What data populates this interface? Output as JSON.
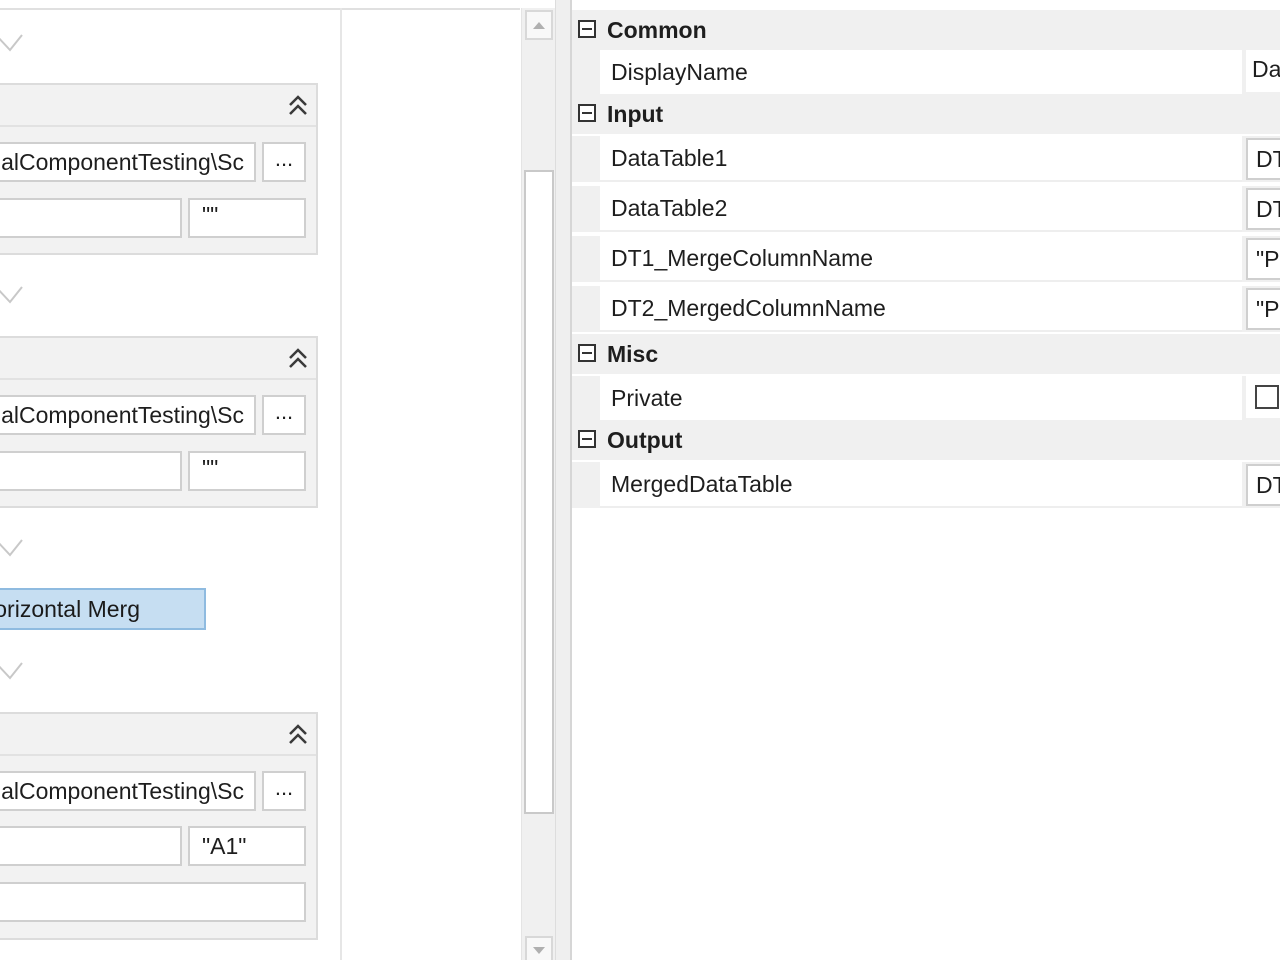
{
  "designer": {
    "activities": [
      {
        "path_value": "C:\\Test\\FunctionalComponentTesting\\Sc",
        "browse_label": "...",
        "sheet_value": "",
        "range_value": "\"\""
      },
      {
        "path_value": "C:\\Test\\FunctionalComponentTesting\\Sc",
        "browse_label": "...",
        "sheet_value": "",
        "range_value": "\"\""
      },
      {
        "path_value": "C:\\Test\\FunctionalComponentTesting\\Sc",
        "browse_label": "...",
        "sheet_value": "",
        "range_value": "\"A1\"",
        "extra_value": ""
      }
    ],
    "selected_activity_label": "Horizontal Merg"
  },
  "properties": {
    "categories": [
      {
        "label": "Common",
        "items": [
          {
            "name": "DisplayName",
            "value": "Da"
          }
        ]
      },
      {
        "label": "Input",
        "items": [
          {
            "name": "DataTable1",
            "value": "DT"
          },
          {
            "name": "DataTable2",
            "value": "DT"
          },
          {
            "name": "DT1_MergeColumnName",
            "value": "\"P"
          },
          {
            "name": "DT2_MergedColumnName",
            "value": "\"P"
          }
        ]
      },
      {
        "label": "Misc",
        "items": [
          {
            "name": "Private",
            "checked": false
          }
        ]
      },
      {
        "label": "Output",
        "items": [
          {
            "name": "MergedDataTable",
            "value": "DT"
          }
        ]
      }
    ]
  },
  "icons": {
    "flow_arrow": "flow-arrow-icon",
    "collapse": "double-chevron-up-icon",
    "scroll_up": "triangle-up-icon",
    "scroll_down": "triangle-down-icon",
    "category_toggle": "minus-box-icon"
  },
  "colors": {
    "selection_fill": "#c6def2",
    "selection_border": "#8fbbe0",
    "panel_gray": "#f0f0f0"
  }
}
